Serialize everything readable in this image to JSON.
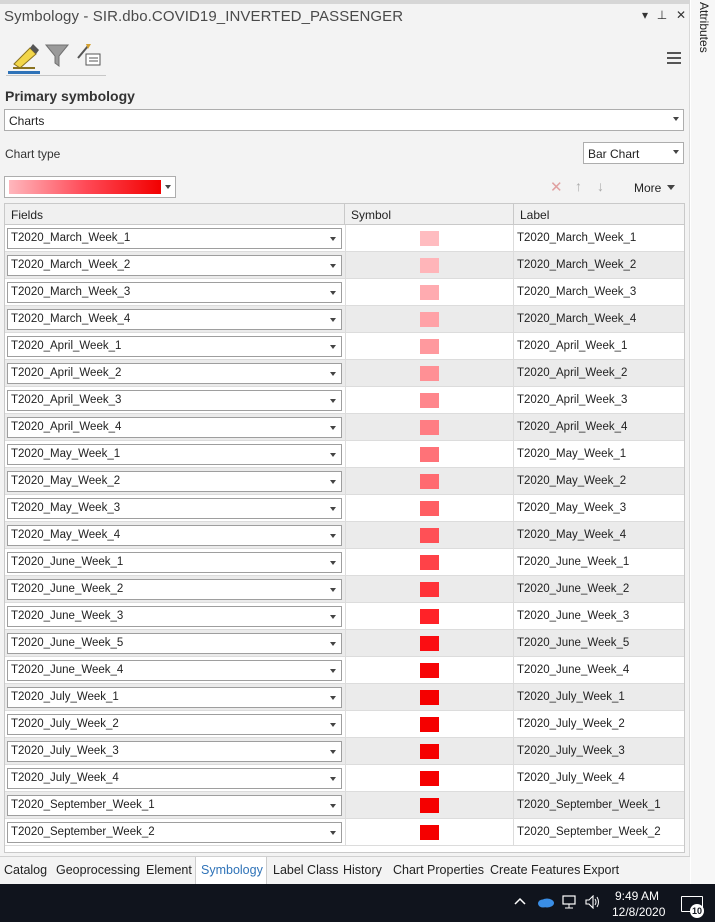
{
  "pane": {
    "title": "Symbology - SIR.dbo.COVID19_INVERTED_PASSENGER",
    "window_buttons": [
      "▾",
      "⊥",
      "✕"
    ]
  },
  "side_panel": {
    "attributes_label": "Attributes"
  },
  "section_title": "Primary symbology",
  "primary_symbology": {
    "value": "Charts"
  },
  "chart_type": {
    "label": "Chart type",
    "value": "Bar Chart"
  },
  "list_toolbar": {
    "more_label": "More"
  },
  "grid": {
    "headers": [
      "Fields",
      "Symbol",
      "Label"
    ],
    "rows": [
      {
        "field": "T2020_March_Week_1",
        "color": "#ffbcc0",
        "label": "T2020_March_Week_1"
      },
      {
        "field": "T2020_March_Week_2",
        "color": "#ffb5b9",
        "label": "T2020_March_Week_2"
      },
      {
        "field": "T2020_March_Week_3",
        "color": "#ffabb0",
        "label": "T2020_March_Week_3"
      },
      {
        "field": "T2020_March_Week_4",
        "color": "#ffa2a7",
        "label": "T2020_March_Week_4"
      },
      {
        "field": "T2020_April_Week_1",
        "color": "#ff999e",
        "label": "T2020_April_Week_1"
      },
      {
        "field": "T2020_April_Week_2",
        "color": "#ff9095",
        "label": "T2020_April_Week_2"
      },
      {
        "field": "T2020_April_Week_3",
        "color": "#ff868c",
        "label": "T2020_April_Week_3"
      },
      {
        "field": "T2020_April_Week_4",
        "color": "#ff7d83",
        "label": "T2020_April_Week_4"
      },
      {
        "field": "T2020_May_Week_1",
        "color": "#ff7278",
        "label": "T2020_May_Week_1"
      },
      {
        "field": "T2020_May_Week_2",
        "color": "#ff6a70",
        "label": "T2020_May_Week_2"
      },
      {
        "field": "T2020_May_Week_3",
        "color": "#ff5e63",
        "label": "T2020_May_Week_3"
      },
      {
        "field": "T2020_May_Week_4",
        "color": "#ff5056",
        "label": "T2020_May_Week_4"
      },
      {
        "field": "T2020_June_Week_1",
        "color": "#ff4248",
        "label": "T2020_June_Week_1"
      },
      {
        "field": "T2020_June_Week_2",
        "color": "#ff3238",
        "label": "T2020_June_Week_2"
      },
      {
        "field": "T2020_June_Week_3",
        "color": "#ff2228",
        "label": "T2020_June_Week_3"
      },
      {
        "field": "T2020_June_Week_5",
        "color": "#fb0d12",
        "label": "T2020_June_Week_5"
      },
      {
        "field": "T2020_June_Week_4",
        "color": "#f70507",
        "label": "T2020_June_Week_4"
      },
      {
        "field": "T2020_July_Week_1",
        "color": "#f50000",
        "label": "T2020_July_Week_1"
      },
      {
        "field": "T2020_July_Week_2",
        "color": "#f50000",
        "label": "T2020_July_Week_2"
      },
      {
        "field": "T2020_July_Week_3",
        "color": "#f50000",
        "label": "T2020_July_Week_3"
      },
      {
        "field": "T2020_July_Week_4",
        "color": "#f50000",
        "label": "T2020_July_Week_4"
      },
      {
        "field": "T2020_September_Week_1",
        "color": "#f50000",
        "label": "T2020_September_Week_1"
      },
      {
        "field": "T2020_September_Week_2",
        "color": "#f50000",
        "label": "T2020_September_Week_2"
      }
    ]
  },
  "bottom_tabs": [
    "Catalog",
    "Geoprocessing",
    "Element",
    "Symbology",
    "Label Class",
    "History",
    "Chart Properties",
    "Create Features",
    "Export"
  ],
  "active_tab": "Symbology",
  "taskbar": {
    "time": "9:49 AM",
    "date": "12/8/2020",
    "notification_count": "10"
  },
  "colors": {
    "accent": "#2f73b8",
    "ramp_start": "#ffb7bd",
    "ramp_end": "#f20000"
  }
}
